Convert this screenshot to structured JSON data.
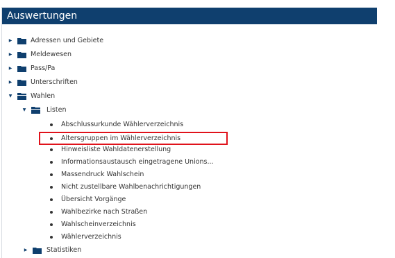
{
  "panel": {
    "title": "Auswertungen"
  },
  "tree": {
    "top": [
      {
        "label": "Adressen und Gebiete"
      },
      {
        "label": "Meldewesen"
      },
      {
        "label": "Pass/Pa"
      },
      {
        "label": "Unterschriften"
      },
      {
        "label": "Wahlen"
      }
    ],
    "wahlen_children": {
      "listen": {
        "label": "Listen",
        "items": [
          "Abschlussurkunde Wählerverzeichnis",
          "Altersgruppen im Wählerverzeichnis",
          "Hinweisliste Wahldatenerstellung",
          "Informationsaustausch eingetragene Unions...",
          "Massendruck Wahlschein",
          "Nicht zustellbare Wahlbenachrichtigungen",
          "Übersicht Vorgänge",
          "Wahlbezirke nach Straßen",
          "Wahlscheinverzeichnis",
          "Wählerverzeichnis"
        ]
      },
      "statistiken": {
        "label": "Statistiken"
      }
    },
    "highlighted_item": "Altersgruppen im Wählerverzeichnis"
  },
  "icons": {
    "collapsed_arrow": "▶",
    "expanded_arrow": "▼",
    "folder_closed": "folder-icon",
    "folder_open": "folder-open-icon"
  },
  "colors": {
    "header_bg": "#0f3f6e",
    "folder": "#0f3f6e",
    "highlight": "#e0121b"
  }
}
